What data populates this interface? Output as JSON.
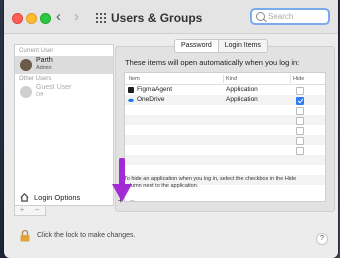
{
  "window": {
    "title": "Users & Groups",
    "nav_back": "‹",
    "nav_forward": "›"
  },
  "search": {
    "placeholder": "Search",
    "value": ""
  },
  "sidebar": {
    "current_user_label": "Current User",
    "other_users_label": "Other Users",
    "users": [
      {
        "name": "Parth",
        "role": "Admin",
        "selected": true
      },
      {
        "name": "Guest User",
        "role": "Off",
        "selected": false
      }
    ],
    "login_options_label": "Login Options",
    "add_symbol": "+",
    "remove_symbol": "–"
  },
  "tabs": [
    {
      "label": "Password",
      "active": false
    },
    {
      "label": "Login Items",
      "active": true
    }
  ],
  "panel": {
    "intro": "These items will open automatically when you log in:",
    "columns": [
      "Item",
      "Kind",
      "Hide"
    ],
    "items": [
      {
        "name": "FigmaAgent",
        "kind": "Application",
        "hide": false,
        "icon": "figma-agent-icon"
      },
      {
        "name": "OneDrive",
        "kind": "Application",
        "hide": true,
        "icon": "onedrive-icon"
      }
    ],
    "hint_line1": "To hide an application when you log in, select the checkbox in the Hide",
    "hint_line2": "column next to the application.",
    "add_symbol": "+",
    "remove_symbol": "–"
  },
  "footer": {
    "lock_text": "Click the lock to make changes.",
    "help_symbol": "?"
  },
  "colors": {
    "accent": "#2f7cf6",
    "annotation_arrow": "#a22bd6"
  }
}
